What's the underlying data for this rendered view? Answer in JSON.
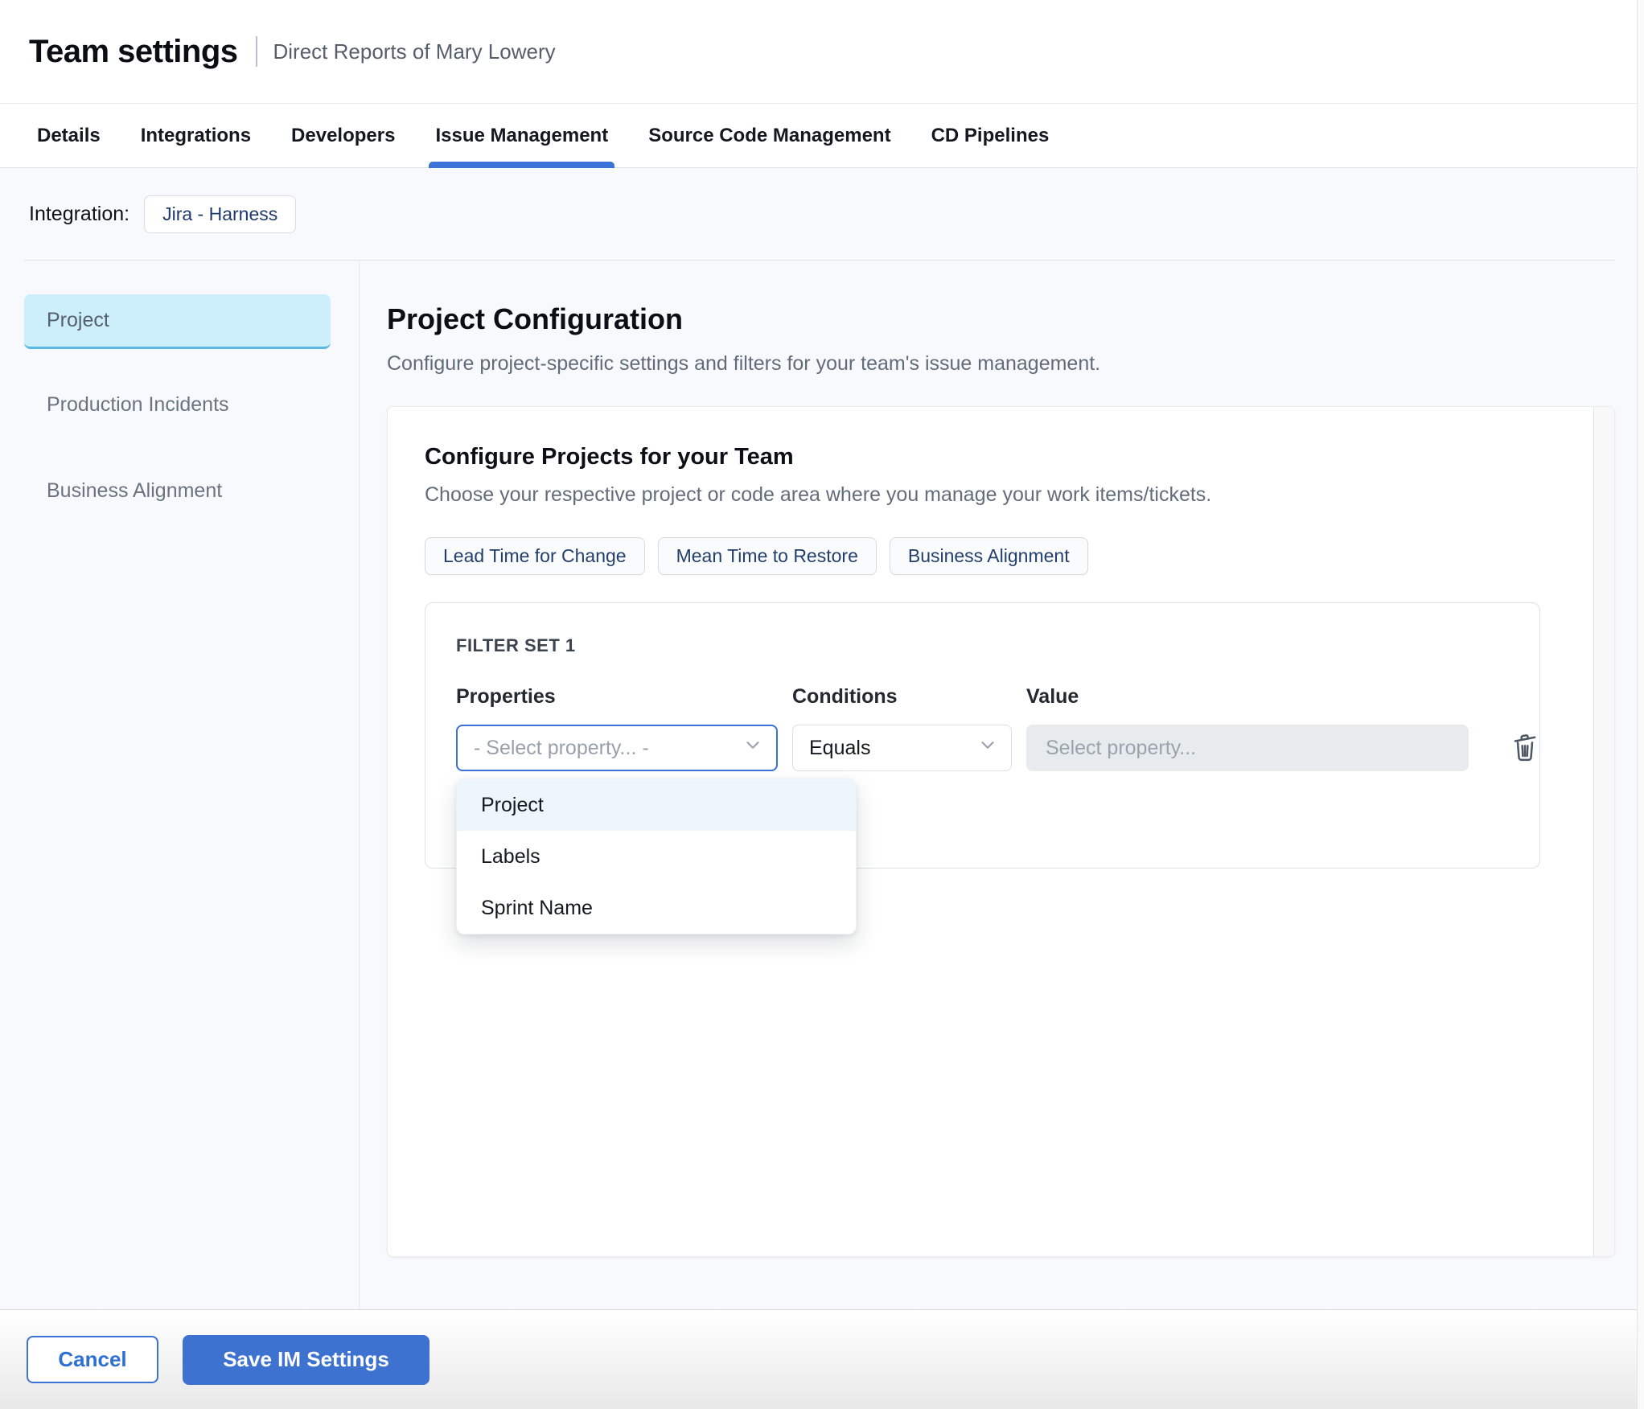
{
  "header": {
    "title": "Team settings",
    "subtitle": "Direct Reports of Mary Lowery"
  },
  "tabs": [
    {
      "label": "Details",
      "active": false
    },
    {
      "label": "Integrations",
      "active": false
    },
    {
      "label": "Developers",
      "active": false
    },
    {
      "label": "Issue Management",
      "active": true
    },
    {
      "label": "Source Code Management",
      "active": false
    },
    {
      "label": "CD Pipelines",
      "active": false
    }
  ],
  "integration": {
    "label": "Integration:",
    "value": "Jira - Harness"
  },
  "sidebar": {
    "items": [
      {
        "label": "Project",
        "active": true
      },
      {
        "label": "Production Incidents",
        "active": false
      },
      {
        "label": "Business Alignment",
        "active": false
      }
    ]
  },
  "main": {
    "title": "Project Configuration",
    "description": "Configure project-specific settings and filters for your team's issue management."
  },
  "card": {
    "title": "Configure Projects for your Team",
    "description": "Choose your respective project or code area where you manage your work items/tickets.",
    "chips": [
      {
        "label": "Lead Time for Change"
      },
      {
        "label": "Mean Time to Restore"
      },
      {
        "label": "Business Alignment"
      }
    ]
  },
  "filter_set": {
    "title": "FILTER SET 1",
    "columns": {
      "properties": "Properties",
      "conditions": "Conditions",
      "value": "Value"
    },
    "property_select": {
      "value": "- Select property... -"
    },
    "condition_select": {
      "value": "Equals"
    },
    "value_input": {
      "placeholder": "Select property..."
    },
    "options": [
      {
        "label": "Project",
        "highlighted": true
      },
      {
        "label": "Labels",
        "highlighted": false
      },
      {
        "label": "Sprint Name",
        "highlighted": false
      }
    ]
  },
  "footer": {
    "cancel_label": "Cancel",
    "save_label": "Save IM Settings"
  },
  "icons": {
    "trash": "trash-icon",
    "chevron": "chevron-down-icon"
  },
  "colors": {
    "accent_blue": "#3d72d1",
    "tab_underline": "#3b73d8",
    "sidebar_active_bg": "#cdeffb",
    "sidebar_active_border": "#58b8e2",
    "dropdown_highlight": "#edf6fa",
    "chip_text": "#223f6b",
    "content_bg": "#f7f9fc"
  }
}
